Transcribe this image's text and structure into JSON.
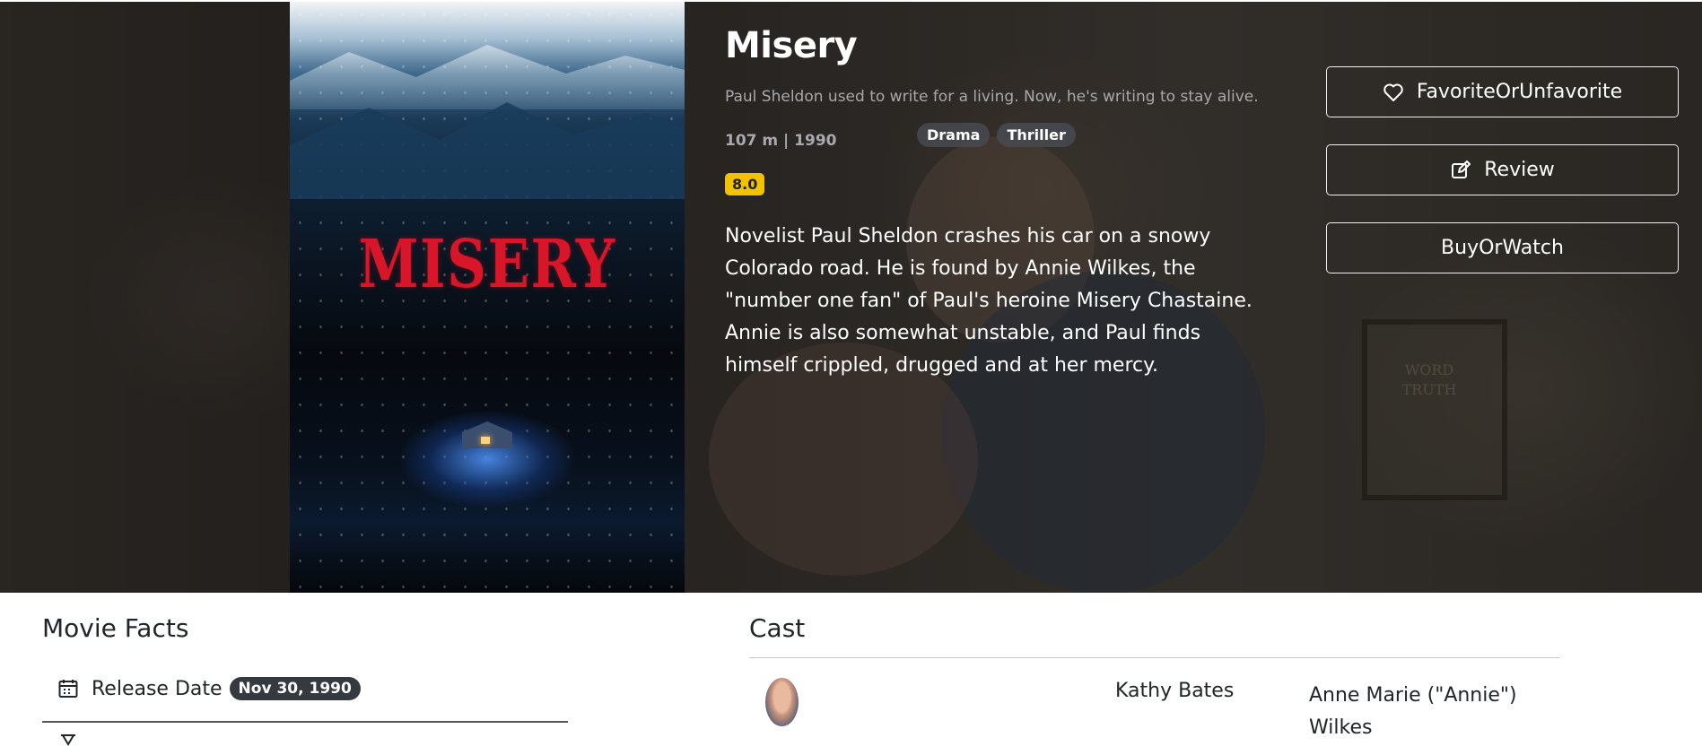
{
  "movie": {
    "title": "Misery",
    "tagline": "Paul Sheldon used to write for a living. Now, he's writing to stay alive.",
    "meta": "107 m | 1990",
    "genres": [
      "Drama",
      "Thriller"
    ],
    "rating": "8.0",
    "overview": "Novelist Paul Sheldon crashes his car on a snowy Colorado road. He is found by Annie Wilkes, the \"number one fan\" of Paul's heroine Misery Chastaine. Annie is also somewhat unstable, and Paul finds himself crippled, drugged and at her mercy.",
    "poster_title": "MISERY",
    "backdrop_frame_text": "WORD TRUTH"
  },
  "actions": {
    "favorite_label": "FavoriteOrUnfavorite",
    "review_label": "Review",
    "buy_label": "BuyOrWatch"
  },
  "facts": {
    "heading": "Movie Facts",
    "release_label": "Release Date",
    "release_value": "Nov 30, 1990"
  },
  "cast": {
    "heading": "Cast",
    "members": [
      {
        "name": "Kathy Bates",
        "character": "Anne Marie (\"Annie\") Wilkes"
      }
    ]
  },
  "icons": {
    "favorite": "heart-icon",
    "review": "edit-icon",
    "release": "calendar-icon",
    "runtime": "hourglass-icon"
  },
  "colors": {
    "rating_badge": "#f2c200",
    "genre_badge": "#464a50",
    "date_badge": "#343a40"
  }
}
